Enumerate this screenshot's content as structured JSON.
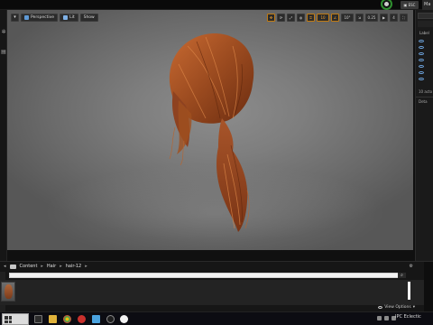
{
  "top_bar": {
    "chip_label": "▣ ESC",
    "right_label": "Ma"
  },
  "viewport": {
    "perspective_label": "Perspective",
    "lit_label": "Lit",
    "show_label": "Show",
    "snap_grid_value": "10",
    "snap_rotate_value": "10°",
    "snap_scale_value": "0.25",
    "camera_speed_value": "4"
  },
  "right_panel": {
    "label": "Label",
    "count": "10 acto",
    "details": "Deta"
  },
  "content_browser": {
    "breadcrumbs": [
      "Content",
      "Hair",
      "hair-12"
    ],
    "view_options_label": "View Options"
  },
  "taskbar": {
    "tray_text": "IPC  Eclectic"
  },
  "colors": {
    "accent_orange": "#f0a030",
    "viewport_gray": "#7e7e7e",
    "hair_auburn": "#9a4a1f"
  }
}
